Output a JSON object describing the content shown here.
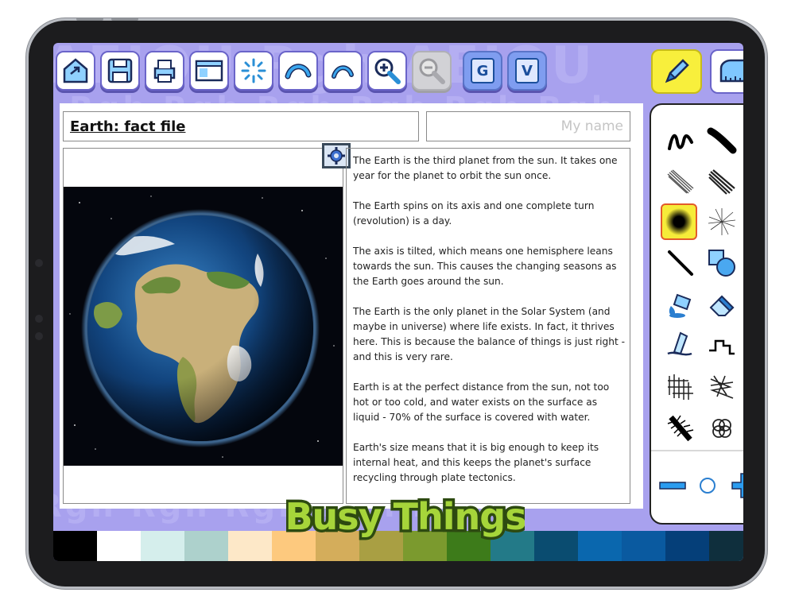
{
  "toolbar": {
    "buttons": [
      {
        "name": "home-button",
        "icon": "home-export-icon"
      },
      {
        "name": "save-button",
        "icon": "floppy-disk-icon"
      },
      {
        "name": "print-button",
        "icon": "printer-icon"
      },
      {
        "name": "layout-button",
        "icon": "layout-window-icon"
      },
      {
        "name": "reset-button",
        "icon": "sparkle-burst-icon"
      },
      {
        "name": "undo-button",
        "icon": "undo-arrow-icon"
      },
      {
        "name": "redo-button",
        "icon": "redo-arrow-icon"
      },
      {
        "name": "zoom-in-button",
        "icon": "zoom-in-icon"
      },
      {
        "name": "zoom-out-button",
        "icon": "zoom-out-icon",
        "disabled": true
      }
    ],
    "grid_label": "G",
    "vocab_label": "V"
  },
  "document": {
    "title": "Earth: fact file",
    "name_placeholder": "My name",
    "paragraphs": [
      "The Earth is the third planet from the sun. It takes one year for the planet to orbit the sun once.",
      "The Earth spins on its axis and one complete turn (revolution) is a day.",
      "The axis is tilted, which means one hemisphere leans towards the sun. This causes the changing seasons as the Earth goes around the sun.",
      "The Earth is the only planet in the Solar System (and maybe in universe) where life exists. In fact, it thrives here. This is because the balance of things is just right - and this is very rare.",
      "Earth is at the perfect distance from the sun, not too hot or too cold, and water exists on the surface as liquid - 70% of the surface is covered with water.",
      "Earth's size means that it is big enough to keep its internal heat, and this keeps the planet's surface recycling through plate tectonics."
    ]
  },
  "tools": {
    "items": [
      "squiggle-pen-icon",
      "marker-icon",
      "pencil-hatch-icon",
      "crayon-hatch-icon",
      "airbrush-icon",
      "spray-icon",
      "line-icon",
      "shape-icon",
      "fill-bucket-icon",
      "eraser-icon",
      "smudge-icon",
      "step-line-icon",
      "hatch-grid-icon",
      "scribble-hatch-icon",
      "fur-brush-icon",
      "loop-brush-icon"
    ],
    "selected_index": 4
  },
  "palette": [
    "#000000",
    "#ffffff",
    "#d5eeec",
    "#add1cc",
    "#fde8c8",
    "#fdc97e",
    "#d4ad5b",
    "#a99f43",
    "#7b9a2e",
    "#3d7b1a",
    "#237a88",
    "#0a4c70",
    "#0a67ae",
    "#0a5aa0",
    "#053f79",
    "#0f2f3d"
  ],
  "brand": {
    "logo_text": "Busy Things",
    "primary": "#a8a1ee",
    "accent": "#f6ec39"
  }
}
